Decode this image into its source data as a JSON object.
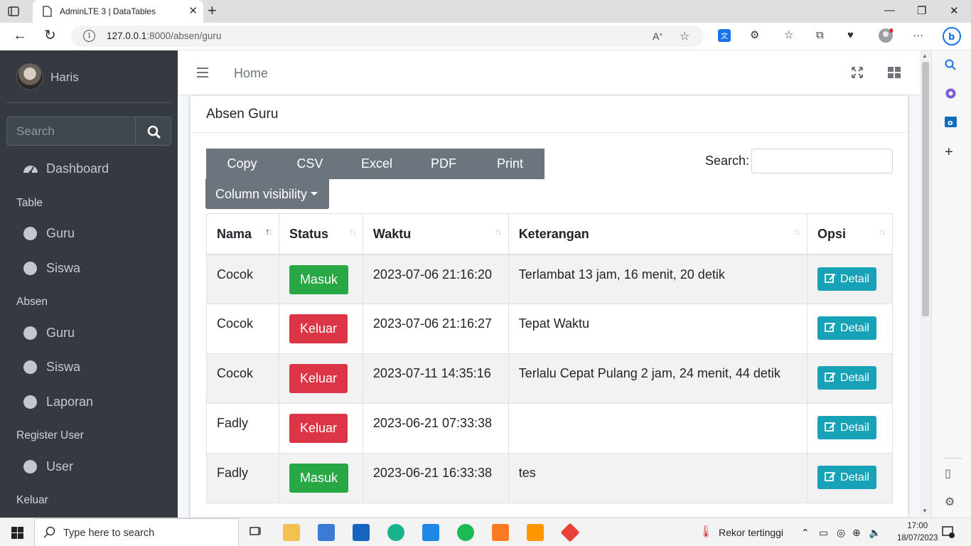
{
  "browser": {
    "tab_title": "AdminLTE 3 | DataTables",
    "url_host": "127.0.0.1",
    "url_rest": ":8000/absen/guru"
  },
  "sidebar": {
    "user_name": "Haris",
    "search_placeholder": "Search",
    "dashboard": "Dashboard",
    "headers": [
      "Table",
      "Absen",
      "Register User",
      "Keluar"
    ],
    "table_items": [
      "Guru",
      "Siswa"
    ],
    "absen_items": [
      "Guru",
      "Siswa",
      "Laporan"
    ],
    "register_items": [
      "User"
    ]
  },
  "topnav": {
    "home": "Home"
  },
  "card": {
    "title": "Absen Guru",
    "buttons": [
      "Copy",
      "CSV",
      "Excel",
      "PDF",
      "Print"
    ],
    "column_visibility": "Column visibility",
    "search_label": "Search:",
    "search_value": ""
  },
  "table": {
    "columns": [
      "Nama",
      "Status",
      "Waktu",
      "Keterangan",
      "Opsi"
    ],
    "detail_label": "Detail",
    "rows": [
      {
        "nama": "Cocok",
        "status": "Masuk",
        "waktu": "2023-07-06 21:16:20",
        "keterangan": "Terlambat 13 jam, 16 menit, 20 detik"
      },
      {
        "nama": "Cocok",
        "status": "Keluar",
        "waktu": "2023-07-06 21:16:27",
        "keterangan": "Tepat Waktu"
      },
      {
        "nama": "Cocok",
        "status": "Keluar",
        "waktu": "2023-07-11 14:35:16",
        "keterangan": "Terlalu Cepat Pulang 2 jam, 24 menit, 44 detik"
      },
      {
        "nama": "Fadly",
        "status": "Keluar",
        "waktu": "2023-06-21 07:33:38",
        "keterangan": ""
      },
      {
        "nama": "Fadly",
        "status": "Masuk",
        "waktu": "2023-06-21 16:33:38",
        "keterangan": "tes"
      }
    ]
  },
  "taskbar": {
    "search_placeholder": "Type here to search",
    "weather": "Rekor tertinggi",
    "time": "17:00",
    "date": "18/07/2023"
  },
  "colors": {
    "sidebar": "#343a40",
    "success": "#28a745",
    "danger": "#dc3545",
    "info": "#17a2b8",
    "secondary": "#6c757d"
  }
}
